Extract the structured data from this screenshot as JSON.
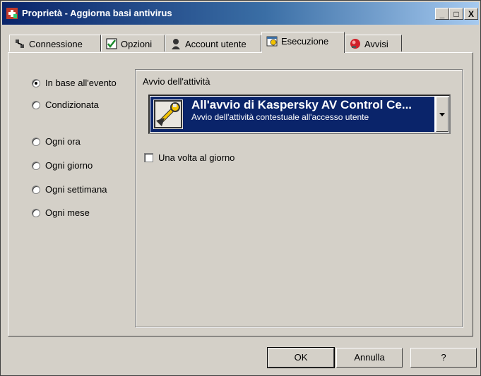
{
  "window": {
    "title": "Proprietà - Aggiorna basi antivirus"
  },
  "title_buttons": {
    "minimize": "_",
    "maximize": "□",
    "close": "X"
  },
  "tabs": [
    {
      "label": "Connessione",
      "icon": "network-icon"
    },
    {
      "label": "Opzioni",
      "icon": "checkmark-icon"
    },
    {
      "label": "Account utente",
      "icon": "user-icon"
    },
    {
      "label": "Esecuzione",
      "icon": "calendar-icon",
      "active": true
    },
    {
      "label": "Avvisi",
      "icon": "alert-icon"
    }
  ],
  "schedule_options": [
    {
      "label": "In base all'evento",
      "selected": true
    },
    {
      "label": "Condizionata",
      "selected": false
    },
    {
      "label": "Ogni ora",
      "selected": false
    },
    {
      "label": "Ogni giorno",
      "selected": false
    },
    {
      "label": "Ogni settimana",
      "selected": false
    },
    {
      "label": "Ogni mese",
      "selected": false
    }
  ],
  "task_start": {
    "group_label": "Avvio dell'attività",
    "selected_title": "All'avvio di Kaspersky AV Control Ce...",
    "selected_subtitle": "Avvio dell'attività contestuale all'accesso utente",
    "once_a_day_label": "Una volta al giorno",
    "once_a_day_checked": false
  },
  "buttons": {
    "ok": "OK",
    "cancel": "Annulla",
    "help": "?"
  },
  "colors": {
    "selection": "#0a246a",
    "face": "#d4d0c8"
  }
}
